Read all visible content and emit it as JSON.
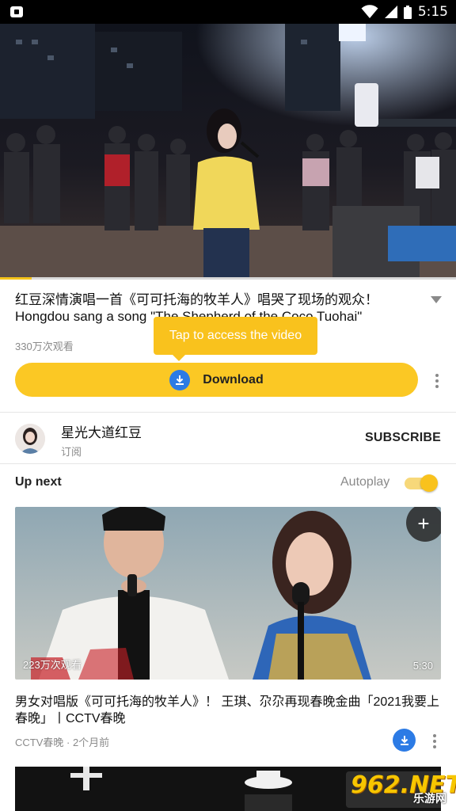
{
  "status_bar": {
    "time": "5:15"
  },
  "video": {
    "title": "红豆深情演唱一首《可可托海的牧羊人》唱哭了现场的观众！ Hongdou sang a song \"The Shepherd of the Coco Tuohai\"",
    "views": "330万次观看",
    "progress": 0.07
  },
  "tooltip": {
    "text": "Tap to access the video"
  },
  "download_button": {
    "label": "Download"
  },
  "channel": {
    "name": "星光大道红豆",
    "subscribe_status": "订阅",
    "subscribe_label": "SUBSCRIBE"
  },
  "up_next": {
    "heading": "Up next",
    "autoplay_label": "Autoplay",
    "autoplay_on": true,
    "items": [
      {
        "views": "223万次观看",
        "duration": "5:30",
        "title": "男女对唱版《可可托海的牧羊人》！ 王琪、尕尕再现春晚金曲「2021我要上春晚」丨CCTV春晚",
        "channel": "CCTV春晚",
        "age": "2个月前",
        "meta": "CCTV春晚 · 2个月前"
      }
    ]
  },
  "watermark": {
    "main": "962.NET",
    "sub": "乐游网"
  },
  "colors": {
    "accent": "#fbc824",
    "blue": "#2c7be5"
  }
}
